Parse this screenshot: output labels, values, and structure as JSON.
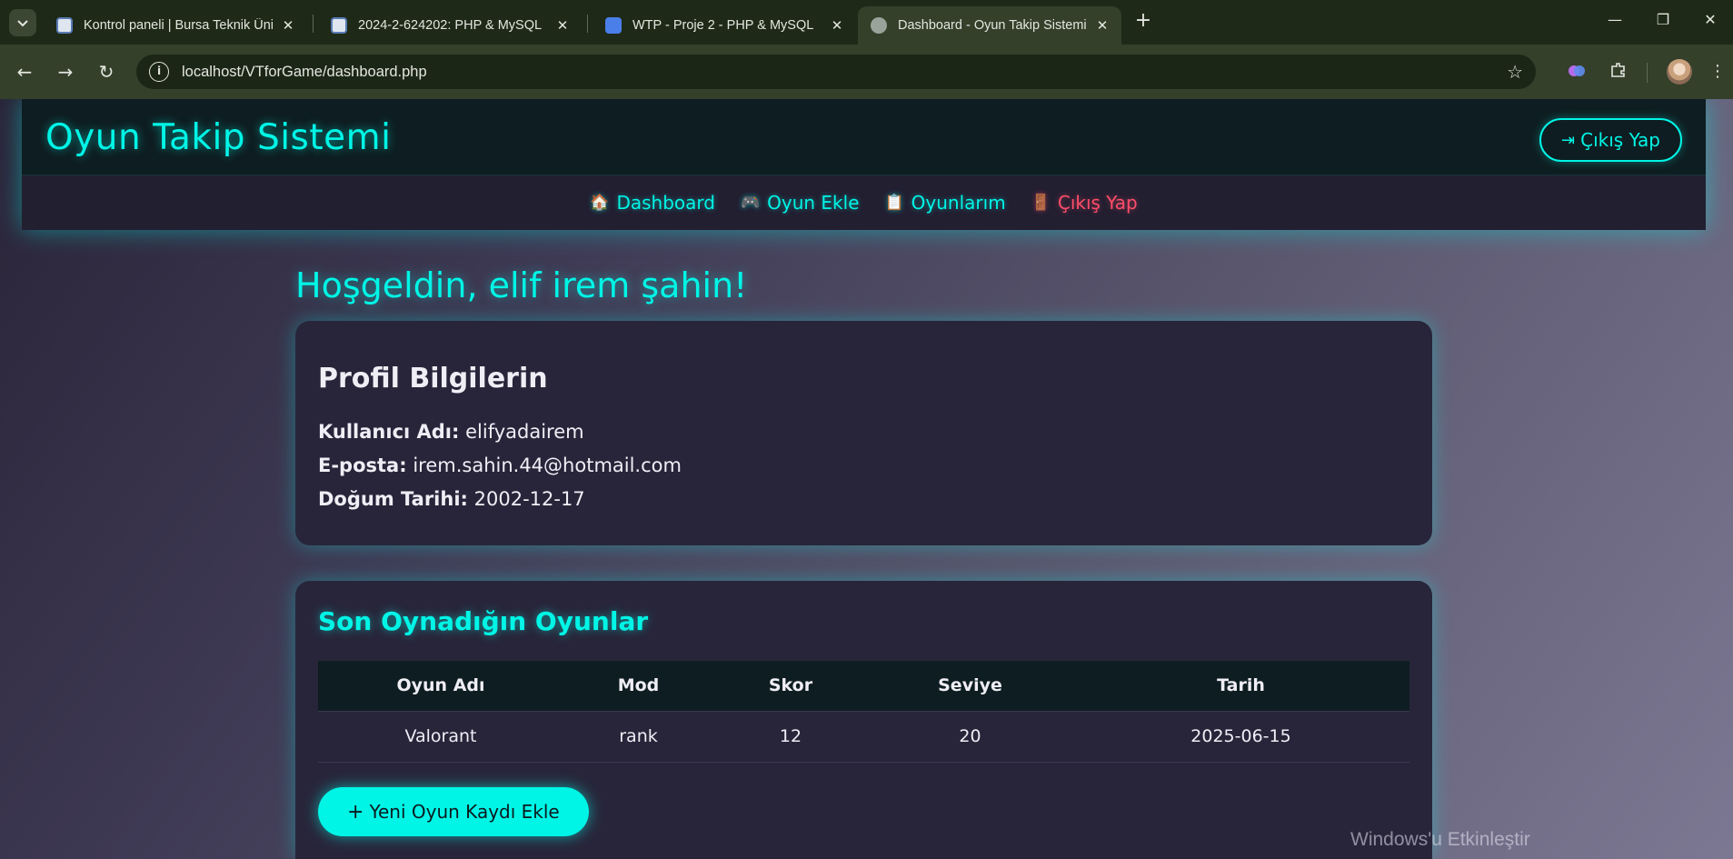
{
  "browser": {
    "tabs": [
      {
        "title": "Kontrol paneli | Bursa Teknik Üniversitesi",
        "active": false
      },
      {
        "title": "2024-2-624202: PHP & MySQL",
        "active": false
      },
      {
        "title": "WTP - Proje 2 - PHP & MySQL",
        "active": false
      },
      {
        "title": "Dashboard - Oyun Takip Sistemi",
        "active": true
      }
    ],
    "close_glyph": "✕",
    "new_tab_glyph": "+",
    "url": "localhost/VTforGame/dashboard.php",
    "icons": [
      "tab-search-icon",
      "back-icon",
      "forward-icon",
      "reload-icon",
      "site-info-icon",
      "bookmark-star-icon",
      "extension-brain-icon",
      "extensions-puzzle-icon",
      "profile-avatar",
      "menu-kebab-icon",
      "minimize-icon",
      "restore-icon",
      "close-window-icon"
    ]
  },
  "site": {
    "title": "Oyun Takip Sistemi",
    "logout_label": "Çıkış Yap",
    "nav": [
      {
        "emoji": "🏠",
        "label": "Dashboard",
        "style": "normal"
      },
      {
        "emoji": "🎮",
        "label": "Oyun Ekle",
        "style": "normal"
      },
      {
        "emoji": "📋",
        "label": "Oyunlarım",
        "style": "normal"
      },
      {
        "emoji": "🚪",
        "label": "Çıkış Yap",
        "style": "danger"
      }
    ]
  },
  "welcome": "Hoşgeldin, elif irem şahin!",
  "profile": {
    "heading": "Profil Bilgilerin",
    "username_label": "Kullanıcı Adı:",
    "username": "elifyadairem",
    "email_label": "E-posta:",
    "email": "irem.sahin.44@hotmail.com",
    "birth_label": "Doğum Tarihi:",
    "birth": "2002-12-17"
  },
  "games": {
    "heading": "Son Oynadığın Oyunlar",
    "columns": [
      "Oyun Adı",
      "Mod",
      "Skor",
      "Seviye",
      "Tarih"
    ],
    "rows": [
      [
        "Valorant",
        "rank",
        "12",
        "20",
        "2025-06-15"
      ]
    ],
    "add_button": "Yeni Oyun Kaydı Ekle"
  },
  "watermark": "Windows'u Etkinleştir",
  "colors": {
    "accent": "#00f5e6",
    "danger": "#ff4d6a",
    "card": "#28253a",
    "header": "#0e1d21"
  }
}
